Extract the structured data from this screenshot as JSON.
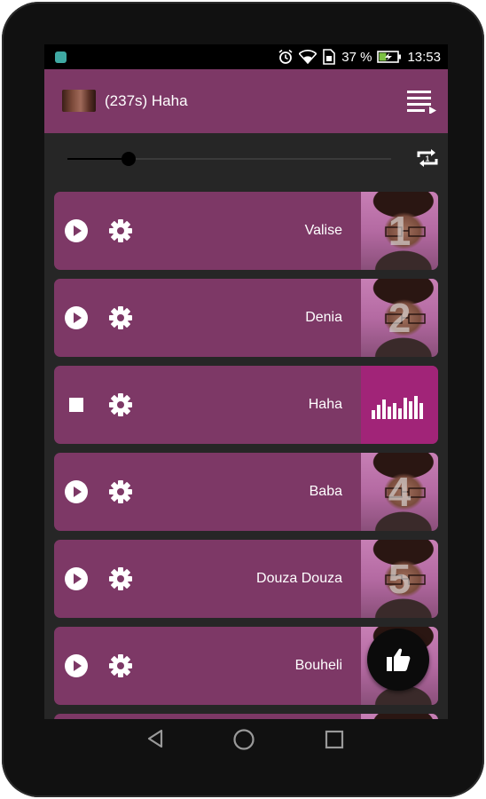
{
  "status_bar": {
    "battery_percent": "37 %",
    "time": "13:53",
    "icons": [
      "app-notification-icon",
      "alarm-icon",
      "wifi-icon",
      "sim-icon",
      "battery-charging-icon"
    ]
  },
  "app_bar": {
    "now_playing_title": "(237s) Haha",
    "menu_icon": "queue-music-icon"
  },
  "player": {
    "progress": 0.19,
    "repeat_icon": "repeat-one-icon"
  },
  "tracks": [
    {
      "label": "Valise",
      "number": "1",
      "state": "stopped",
      "control_icon": "play-icon"
    },
    {
      "label": "Denia",
      "number": "2",
      "state": "stopped",
      "control_icon": "play-icon"
    },
    {
      "label": "Haha",
      "number": "",
      "state": "playing",
      "control_icon": "stop-icon"
    },
    {
      "label": "Baba",
      "number": "4",
      "state": "stopped",
      "control_icon": "play-icon"
    },
    {
      "label": "Douza Douza",
      "number": "5",
      "state": "stopped",
      "control_icon": "play-icon"
    },
    {
      "label": "Bouheli",
      "number": "",
      "state": "stopped",
      "control_icon": "play-icon"
    }
  ],
  "fab": {
    "icon": "thumb-up-icon"
  },
  "nav": {
    "icons": [
      "back-icon",
      "home-icon",
      "recents-icon"
    ]
  },
  "colors": {
    "primary": "#7d3866",
    "playing_accent": "#a12478",
    "background": "#262626"
  }
}
